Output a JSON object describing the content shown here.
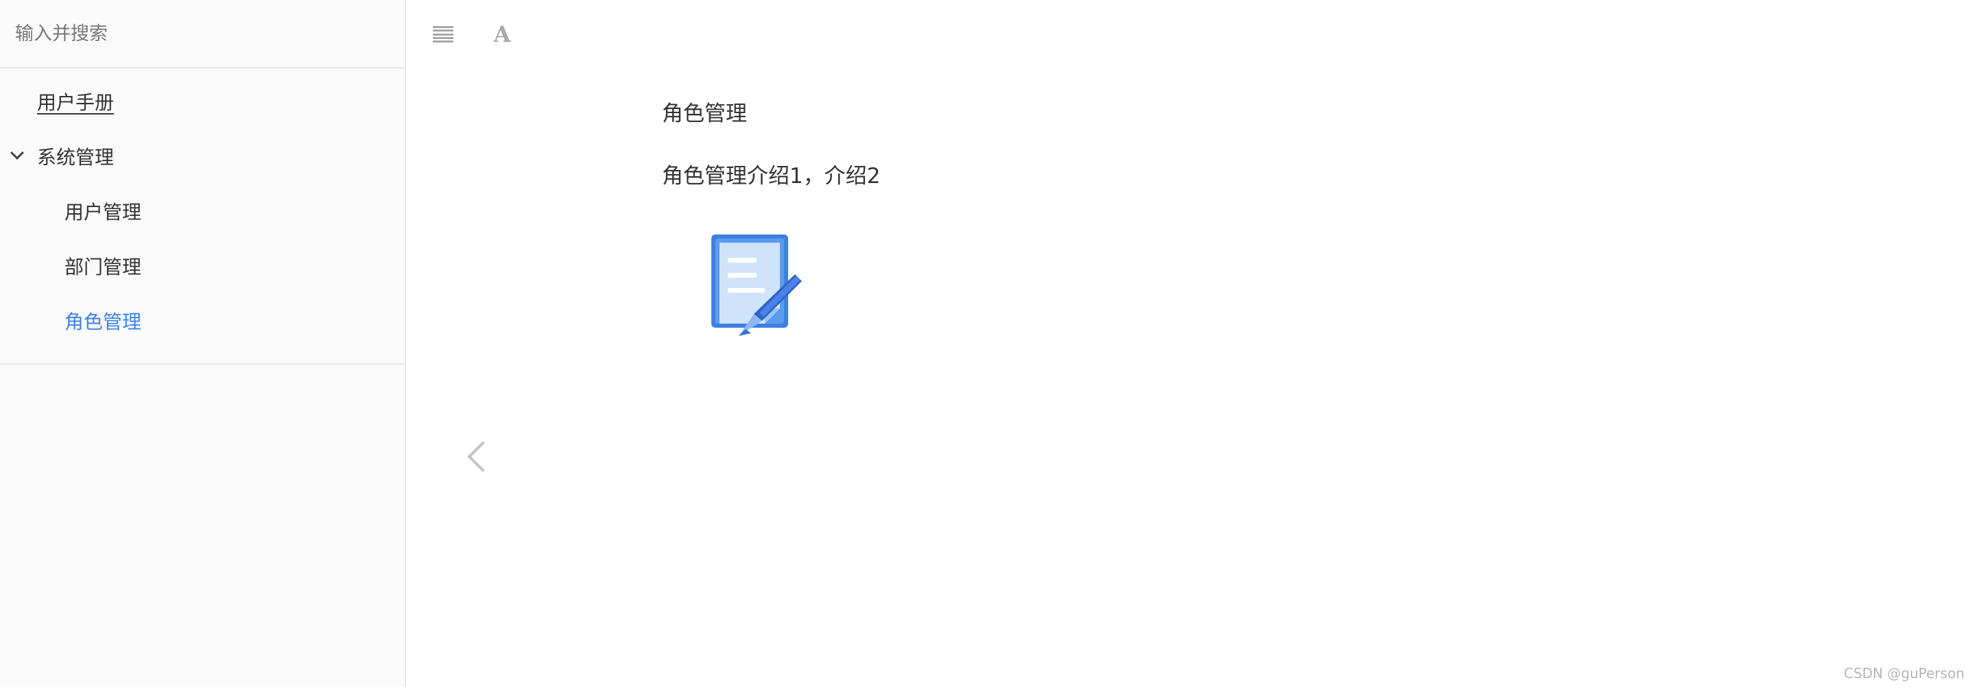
{
  "sidebar": {
    "search": {
      "placeholder": "输入并搜索"
    },
    "toc": [
      {
        "label": "用户手册",
        "level": 0,
        "underline": true
      },
      {
        "label": "系统管理",
        "level": 0,
        "expanded": true
      },
      {
        "label": "用户管理",
        "level": 1
      },
      {
        "label": "部门管理",
        "level": 1
      },
      {
        "label": "角色管理",
        "level": 1,
        "active": true
      }
    ]
  },
  "toolbar": {
    "menu_icon": "menu-icon",
    "font_icon": "font-settings-icon",
    "font_glyph": "A"
  },
  "content": {
    "title": "角色管理",
    "text": "角色管理介绍1，介绍2",
    "image_icon": "document-edit-icon"
  },
  "navigation": {
    "prev_icon": "chevron-left-icon"
  },
  "watermark": "CSDN @guPerson",
  "colors": {
    "active": "#3b83e8",
    "icon_gray": "#a8a8a8",
    "sidebar_bg": "#fafafa"
  }
}
